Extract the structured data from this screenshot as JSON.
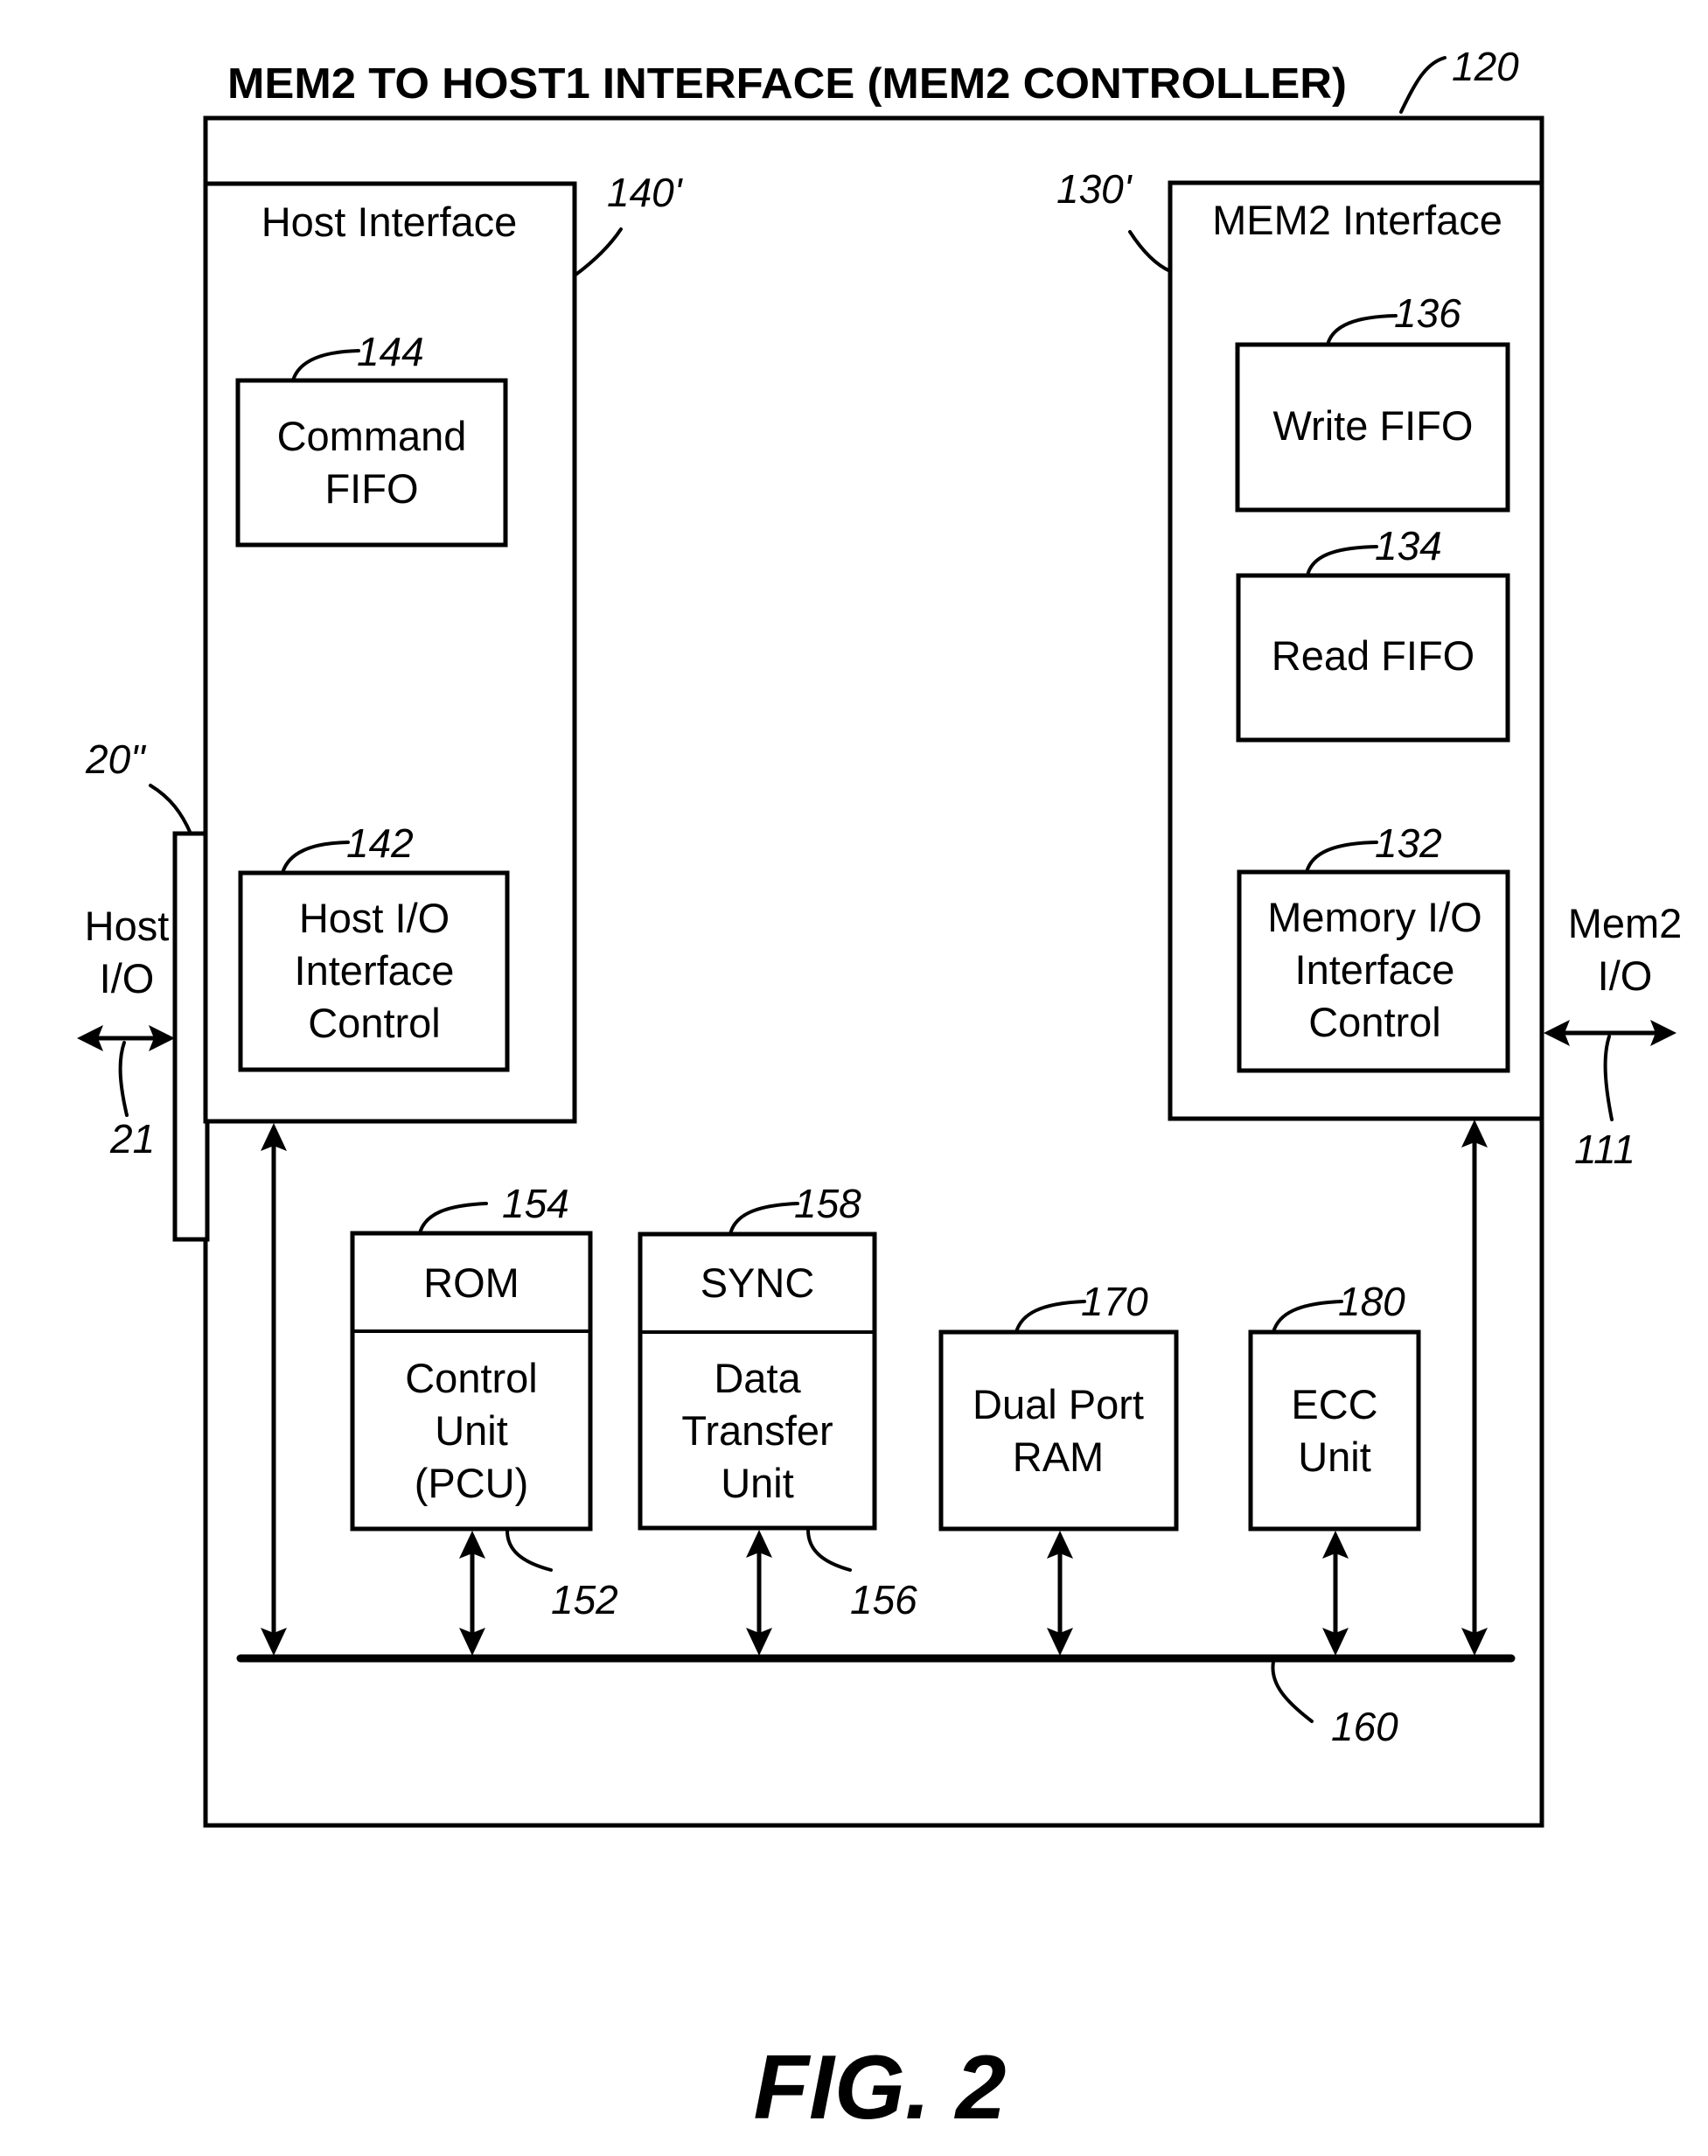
{
  "title": "MEM2 TO HOST1 INTERFACE (MEM2 CONTROLLER)",
  "figure_label": "FIG. 2",
  "refs": {
    "controller": "120",
    "host_interface": "140'",
    "mem2_interface": "130'",
    "command_fifo": "144",
    "host_io_control": "142",
    "write_fifo": "136",
    "read_fifo": "134",
    "memory_io_control": "132",
    "host_port": "20\"",
    "host_io_bus": "21",
    "mem2_io_bus": "111",
    "rom": "154",
    "control_unit": "152",
    "sync": "158",
    "data_transfer_unit": "156",
    "dual_port_ram": "170",
    "ecc_unit": "180",
    "internal_bus": "160"
  },
  "host_interface": {
    "label": "Host Interface",
    "command_fifo": [
      "Command",
      "FIFO"
    ],
    "host_io_control": [
      "Host I/O",
      "Interface",
      "Control"
    ]
  },
  "mem2_interface": {
    "label": "MEM2 Interface",
    "write_fifo": "Write FIFO",
    "read_fifo": "Read FIFO",
    "memory_io_control": [
      "Memory I/O",
      "Interface",
      "Control"
    ]
  },
  "external": {
    "host_io": [
      "Host",
      "I/O"
    ],
    "mem2_io": [
      "Mem2",
      "I/O"
    ]
  },
  "units": {
    "rom": "ROM",
    "control_unit": [
      "Control",
      "Unit",
      "(PCU)"
    ],
    "sync": "SYNC",
    "data_transfer_unit": [
      "Data",
      "Transfer",
      "Unit"
    ],
    "dual_port_ram": [
      "Dual Port",
      "RAM"
    ],
    "ecc_unit": [
      "ECC",
      "Unit"
    ]
  }
}
